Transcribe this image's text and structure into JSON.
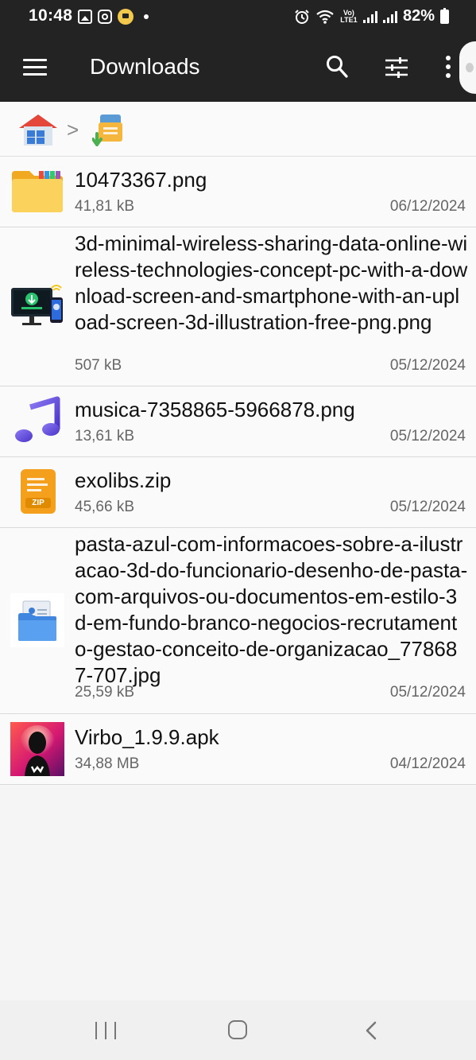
{
  "status_bar": {
    "time": "10:48",
    "battery": "82%",
    "network_label": "Vo) LTE1"
  },
  "app_bar": {
    "title": "Downloads",
    "icons": [
      "menu-icon",
      "search-icon",
      "filter-icon",
      "more-icon"
    ]
  },
  "breadcrumb": {
    "items": [
      "home-icon",
      "downloads-folder-icon"
    ],
    "separator": ">"
  },
  "files": [
    {
      "name": "10473367.png",
      "size": "41,81 kB",
      "date": "06/12/2024",
      "icon": "folder-icon"
    },
    {
      "name": "3d-minimal-wireless-sharing-data-online-wireless-technologies-concept-pc-with-a-download-screen-and-smartphone-with-an-upload-screen-3d-illustration-free-png.png",
      "size": "507 kB",
      "date": "05/12/2024",
      "icon": "computer-phone-thumbnail"
    },
    {
      "name": "musica-7358865-5966878.png",
      "size": "13,61 kB",
      "date": "05/12/2024",
      "icon": "music-note-icon"
    },
    {
      "name": "exolibs.zip",
      "size": "45,66 kB",
      "date": "05/12/2024",
      "icon": "zip-file-icon",
      "zip_label": "ZIP"
    },
    {
      "name": "pasta-azul-com-informacoes-sobre-a-ilustracao-3d-do-funcionario-desenho-de-pasta-com-arquivos-ou-documentos-em-estilo-3d-em-fundo-branco-negocios-recrutamento-gestao-conceito-de-organizacao_778687-707.jpg",
      "size": "25,59 kB",
      "date": "05/12/2024",
      "icon": "blue-folder-thumbnail"
    },
    {
      "name": "Virbo_1.9.9.apk",
      "size": "34,88 MB",
      "date": "04/12/2024",
      "icon": "virbo-app-icon"
    }
  ],
  "nav_bar": {
    "buttons": [
      "recent-apps-button",
      "home-button",
      "back-button"
    ]
  },
  "colors": {
    "toolbar": "#232323",
    "background": "#f5f5f5",
    "music_purple": "#6a4ce0",
    "zip_orange": "#f4a01c",
    "folder_yellow": "#f7c948"
  }
}
